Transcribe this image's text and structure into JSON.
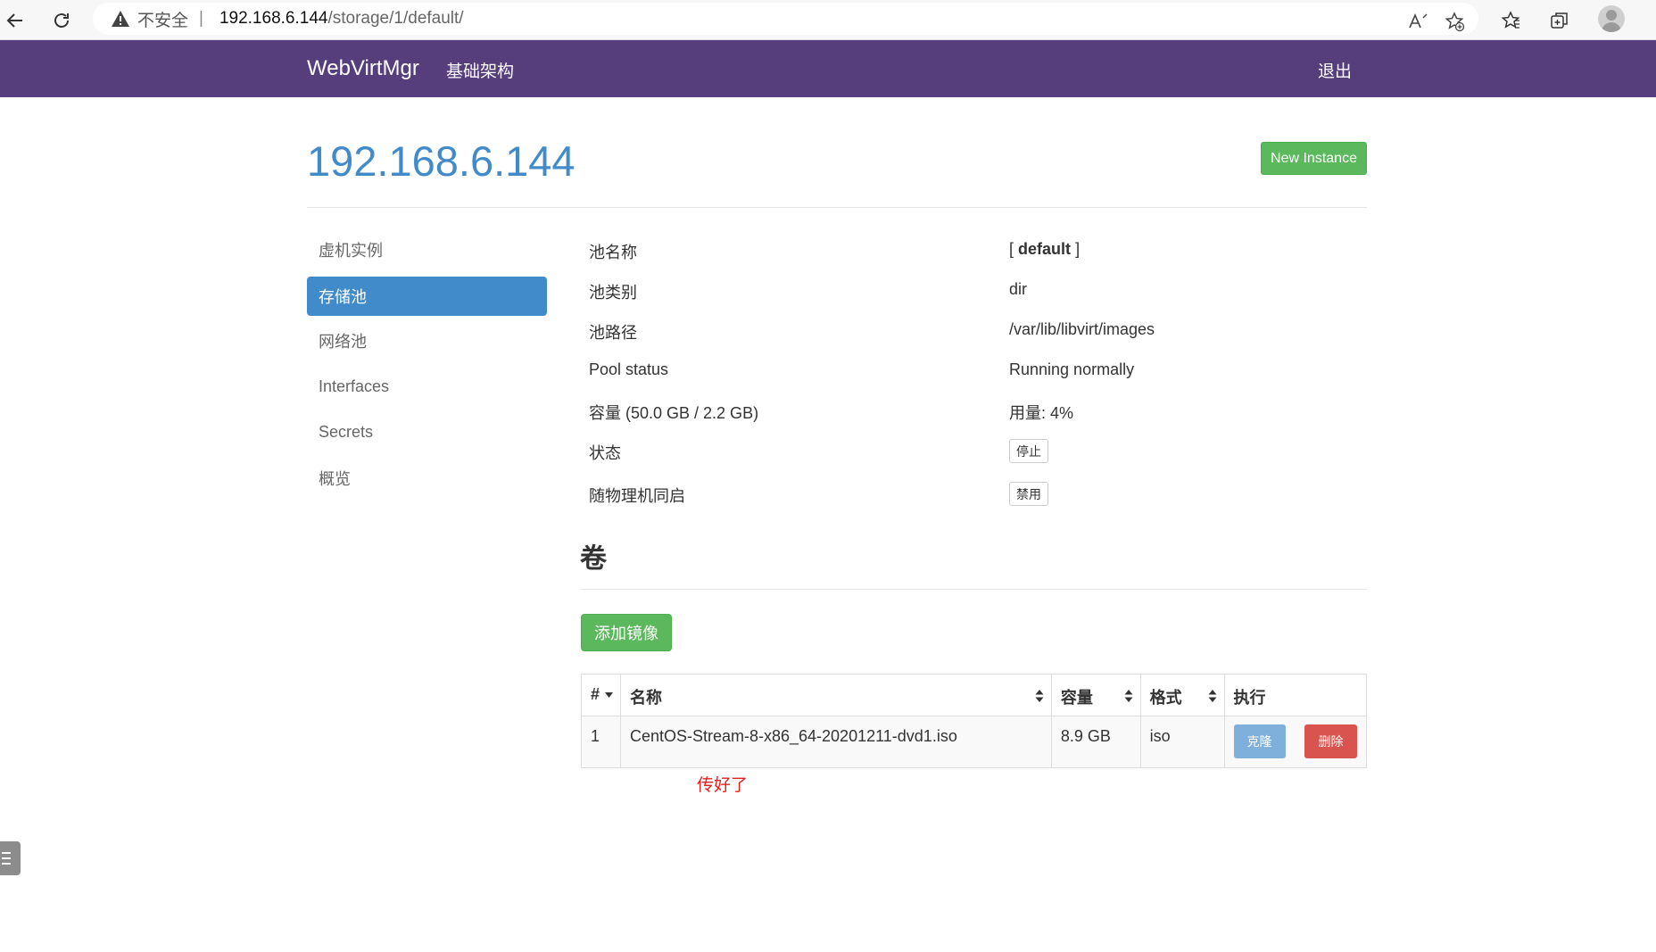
{
  "browser": {
    "insecure_label": "不安全",
    "separator": "|",
    "url_host": "192.168.6.144",
    "url_path": "/storage/1/default/"
  },
  "navbar": {
    "brand": "WebVirtMgr",
    "infra_link": "基础架构",
    "logout_link": "退出"
  },
  "page": {
    "title": "192.168.6.144",
    "new_instance_label": "New Instance"
  },
  "sidebar": {
    "items": [
      {
        "label": "虚机实例"
      },
      {
        "label": "存储池",
        "active": true
      },
      {
        "label": "网络池"
      },
      {
        "label": "Interfaces"
      },
      {
        "label": "Secrets"
      },
      {
        "label": "概览"
      }
    ]
  },
  "pool": {
    "name_label": "池名称",
    "name_open": "[",
    "name_value": "default",
    "name_close": "]",
    "type_label": "池类别",
    "type_value": "dir",
    "path_label": "池路径",
    "path_value": "/var/lib/libvirt/images",
    "status_label": "Pool status",
    "status_value": "Running normally",
    "capacity_label": "容量 (50.0 GB / 2.2 GB)",
    "usage_value": "用量: 4%",
    "state_label": "状态",
    "stop_button": "停止",
    "autostart_label": "随物理机同启",
    "disable_button": "禁用"
  },
  "volumes": {
    "section_title": "卷",
    "add_image_label": "添加镜像",
    "headers": {
      "index": "#",
      "name": "名称",
      "size": "容量",
      "format": "格式",
      "action": "执行"
    },
    "rows": [
      {
        "index": "1",
        "name": "CentOS-Stream-8-x86_64-20201211-dvd1.iso",
        "size": "8.9 GB",
        "format": "iso",
        "clone_label": "克隆",
        "delete_label": "删除"
      }
    ],
    "note": "传好了"
  },
  "colors": {
    "navbar": "#563d7c",
    "primary": "#428bca",
    "success": "#5cb85c",
    "danger": "#d9534f",
    "note": "#e02020"
  }
}
